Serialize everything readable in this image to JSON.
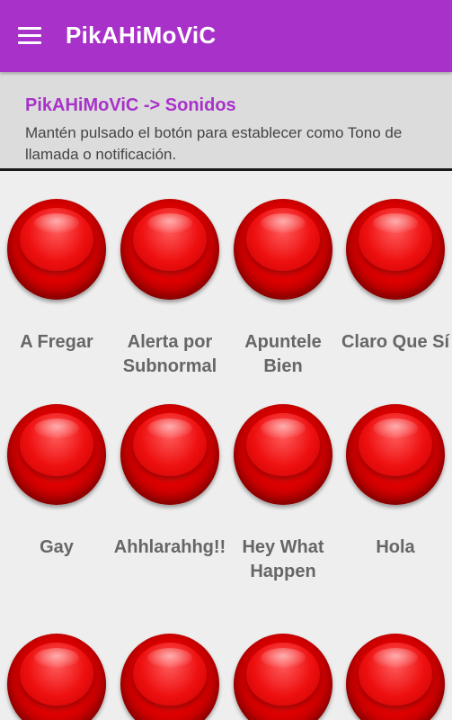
{
  "appbar": {
    "title": "PikAHiMoViC",
    "menu_icon": "hamburger-menu-icon",
    "color": "#a832c9"
  },
  "header": {
    "title": "PikAHiMoViC -> Sonidos",
    "description": "Mantén pulsado el botón para establecer como Tono de llamada o notificación."
  },
  "sounds": [
    {
      "label": "A Fregar"
    },
    {
      "label": "Alerta por Subnormal"
    },
    {
      "label": "Apuntele Bien"
    },
    {
      "label": "Claro Que Sí"
    },
    {
      "label": "Gay"
    },
    {
      "label": "Ahhlarahhg!!"
    },
    {
      "label": "Hey What Happen"
    },
    {
      "label": "Hola"
    },
    {
      "label": ""
    },
    {
      "label": ""
    },
    {
      "label": ""
    },
    {
      "label": ""
    }
  ]
}
